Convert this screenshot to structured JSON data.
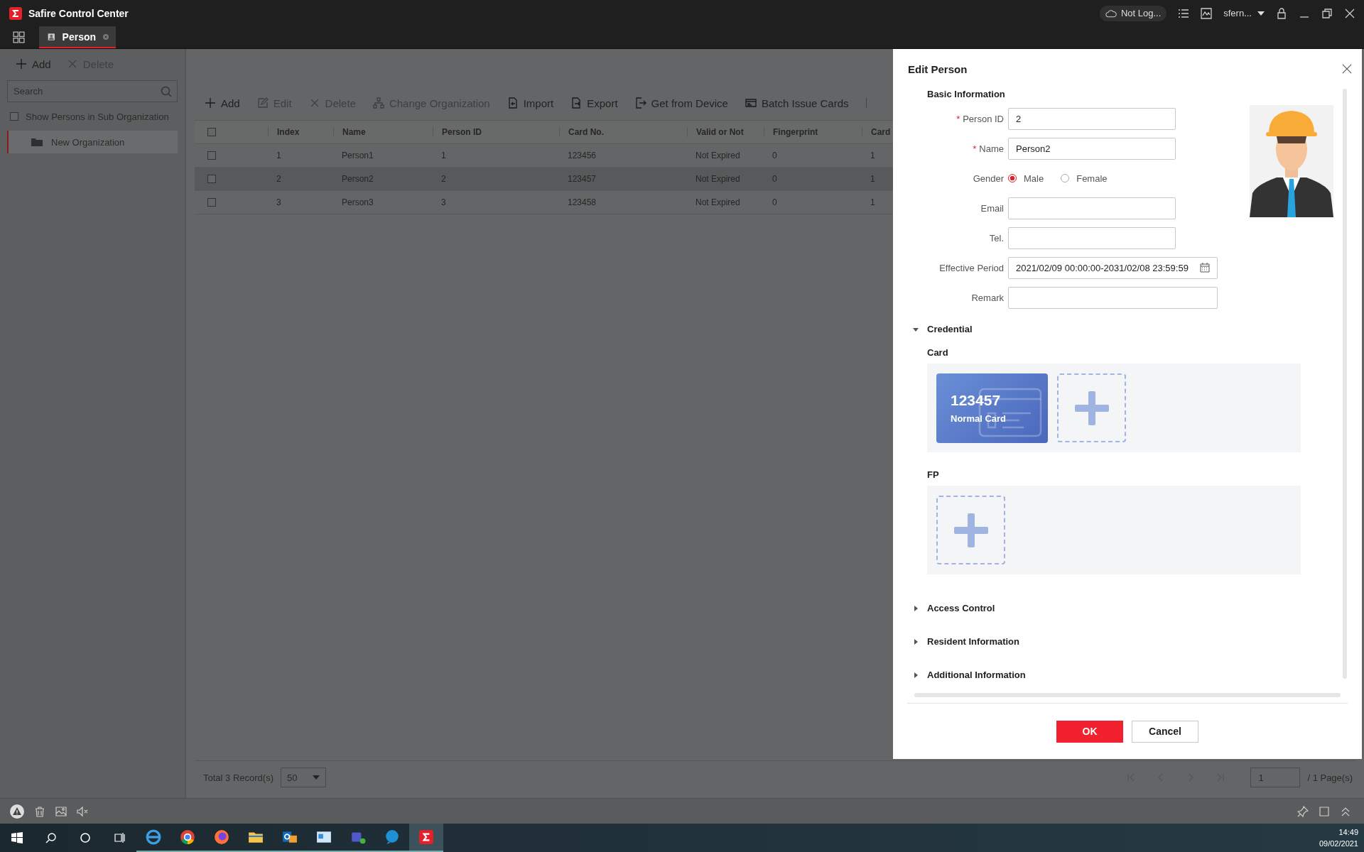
{
  "app": {
    "title": "Safire Control Center",
    "status": "Not Log...",
    "user": "sfern..."
  },
  "tabs": [
    {
      "label": "Person",
      "selected": true
    }
  ],
  "sidebar": {
    "actions": [
      {
        "label": "Add",
        "kind": "add",
        "disabled": false
      },
      {
        "label": "Delete",
        "kind": "delete",
        "disabled": true
      }
    ],
    "search": {
      "placeholder": "Search"
    },
    "sub_org": {
      "label": "Show Persons in Sub Organization",
      "checked": false
    },
    "items": [
      {
        "label": "New Organization",
        "selected": true
      }
    ]
  },
  "toolbar": [
    {
      "label": "Add",
      "kind": "add",
      "disabled": false
    },
    {
      "label": "Edit",
      "kind": "edit",
      "disabled": true
    },
    {
      "label": "Delete",
      "kind": "delete",
      "disabled": true
    },
    {
      "label": "Change Organization",
      "kind": "org",
      "disabled": true
    },
    {
      "label": "Import",
      "kind": "import",
      "disabled": false
    },
    {
      "label": "Export",
      "kind": "export",
      "disabled": false
    },
    {
      "label": "Get from Device",
      "kind": "get",
      "disabled": false
    },
    {
      "label": "Batch Issue Cards",
      "kind": "cards",
      "disabled": false
    }
  ],
  "table": {
    "all_checked": false,
    "columns": [
      "Index",
      "Name",
      "Person ID",
      "Card No.",
      "Valid or Not",
      "Fingerprint",
      "Card"
    ],
    "rows": [
      {
        "checked": false,
        "selected": false,
        "cells": [
          "1",
          "Person1",
          "1",
          "123456",
          "Not Expired",
          "0",
          "1"
        ]
      },
      {
        "checked": false,
        "selected": true,
        "cells": [
          "2",
          "Person2",
          "2",
          "123457",
          "Not Expired",
          "0",
          "1"
        ]
      },
      {
        "checked": false,
        "selected": false,
        "cells": [
          "3",
          "Person3",
          "3",
          "123458",
          "Not Expired",
          "0",
          "1"
        ]
      }
    ]
  },
  "footer": {
    "total": "Total 3 Record(s)",
    "page_size": "50",
    "page": "1",
    "pages": "/ 1 Page(s)"
  },
  "dialog": {
    "title": "Edit Person",
    "section": "Basic Information",
    "fields": [
      {
        "label": "Person ID",
        "kind": "text",
        "marker": "*",
        "wide": false,
        "value": "2"
      },
      {
        "label": "Name",
        "kind": "text",
        "marker": "*",
        "wide": false,
        "value": "Person2"
      },
      {
        "label": "Gender",
        "kind": "radio",
        "options": [
          {
            "label": "Male",
            "selected": true
          },
          {
            "label": "Female",
            "selected": false
          }
        ]
      },
      {
        "label": "Email",
        "kind": "text",
        "wide": false
      },
      {
        "label": "Tel.",
        "kind": "text",
        "wide": false
      },
      {
        "label": "Effective Period",
        "kind": "date",
        "wide": true,
        "value": "2021/02/09 00:00:00-2031/02/08 23:59:59"
      },
      {
        "label": "Remark",
        "kind": "text",
        "wide": true
      }
    ],
    "credential": {
      "label": "Credential",
      "expanded": true,
      "groups": [
        {
          "label": "Card",
          "cards": [
            {
              "number": "123457",
              "type": "Normal Card"
            }
          ]
        },
        {
          "label": "FP"
        }
      ]
    },
    "sections": [
      {
        "label": "Access Control",
        "expanded": false
      },
      {
        "label": "Resident Information",
        "expanded": false
      },
      {
        "label": "Additional Information",
        "expanded": false
      }
    ],
    "buttons": [
      {
        "label": "OK",
        "kind": "primary"
      },
      {
        "label": "Cancel",
        "kind": "secondary"
      }
    ]
  },
  "taskbar": {
    "time": "14:49",
    "date": "09/02/2021"
  }
}
